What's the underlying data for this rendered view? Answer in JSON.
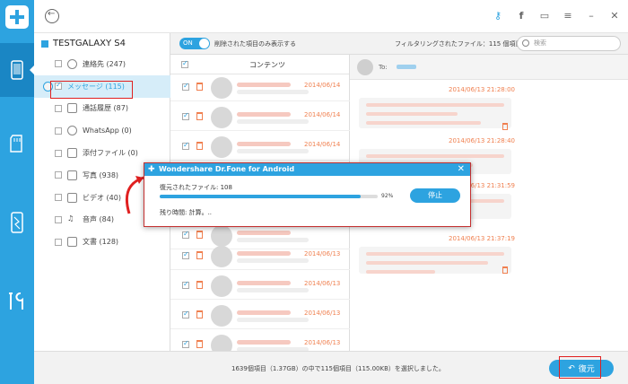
{
  "device": {
    "name": "TESTGALAXY S4"
  },
  "categories": [
    {
      "label": "連絡先 (247)"
    },
    {
      "label": "メッセージ (115)"
    },
    {
      "label": "通話履歴 (87)"
    },
    {
      "label": "WhatsApp (0)"
    },
    {
      "label": "添付ファイル (0)"
    },
    {
      "label": "写真 (938)"
    },
    {
      "label": "ビデオ (40)"
    },
    {
      "label": "音声 (84)"
    },
    {
      "label": "文書 (128)"
    }
  ],
  "toolbar": {
    "toggle_label": "ON",
    "toggle_text": "削除された項目のみ表示する",
    "filter_text": "フィルタリングされたファイル：115 個項目",
    "search_placeholder": "検索"
  },
  "list": {
    "column_header": "コンテンツ",
    "rows": [
      {
        "date": "2014/06/14"
      },
      {
        "date": "2014/06/14"
      },
      {
        "date": "2014/06/14"
      },
      {
        "date": ""
      },
      {
        "date": ""
      },
      {
        "date": ""
      },
      {
        "date": "2014/06/13"
      },
      {
        "date": "2014/06/13"
      },
      {
        "date": "2014/06/13"
      },
      {
        "date": "2014/06/13"
      }
    ]
  },
  "conversation": {
    "to_label": "To:",
    "timestamps": [
      "2014/06/13 21:28:00",
      "2014/06/13 21:28:40",
      "2014/06/13 21:31:59",
      "2014/06/13 21:37:19"
    ]
  },
  "footer": {
    "selection_text": "1639個項目（1.37GB）の中で115個項目（115.00KB）を選択しました。",
    "restore_label": "復元"
  },
  "dialog": {
    "title": "Wondershare Dr.Fone for Android",
    "files_label": "復元されたファイル: 108",
    "progress": 0.92,
    "percent_text": "92%",
    "stop_label": "停止",
    "remaining_label": "残り時間: 計算。.."
  },
  "colors": {
    "accent": "#2da3e0",
    "highlight": "#e02020",
    "date": "#f08050"
  }
}
